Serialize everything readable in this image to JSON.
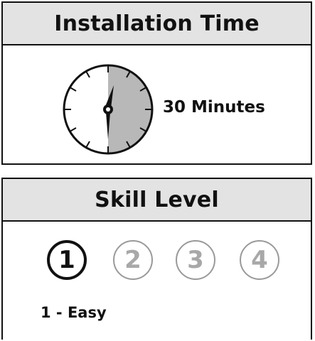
{
  "installation": {
    "title": "Installation Time",
    "time_label": "30 Minutes",
    "minutes": 30,
    "clock_fill_color": "#b8b8b8"
  },
  "skill": {
    "title": "Skill Level",
    "levels": [
      {
        "label": "1",
        "active": true
      },
      {
        "label": "2",
        "active": false
      },
      {
        "label": "3",
        "active": false
      },
      {
        "label": "4",
        "active": false
      }
    ],
    "selected_text": "1 - Easy",
    "active_color": "#111111",
    "inactive_color": "#a8a8a8"
  }
}
